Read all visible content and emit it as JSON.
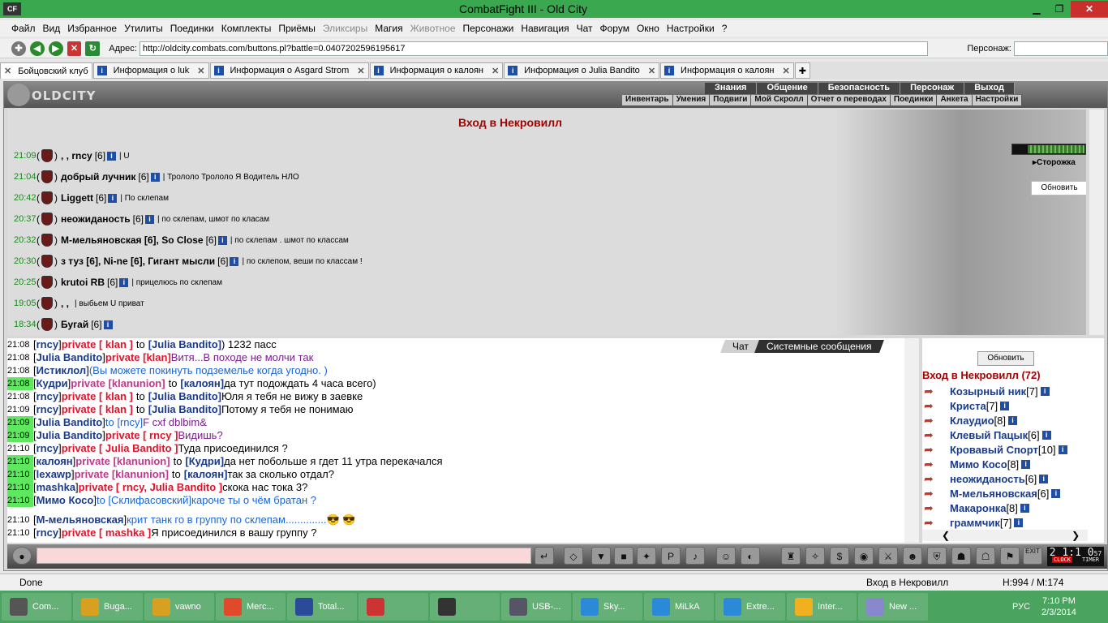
{
  "window": {
    "title": "CombatFight III - Old City",
    "logo": "CF"
  },
  "menu": [
    "Файл",
    "Вид",
    "Избранное",
    "Утилиты",
    "Поединки",
    "Комплекты",
    "Приёмы",
    "Эликсиры",
    "Магия",
    "Животное",
    "Персонажи",
    "Навигация",
    "Чат",
    "Форум",
    "Окно",
    "Настройки",
    "?"
  ],
  "address": {
    "label": "Адрес:",
    "url": "http://oldcity.combats.com/buttons.pl?battle=0.0407202596195617",
    "person_label": "Персонаж:"
  },
  "tabs": [
    {
      "label": "Бойцовский клуб"
    },
    {
      "label": "Информация о luk"
    },
    {
      "label": "Информация о Asgard Strom"
    },
    {
      "label": "Информация о калоян"
    },
    {
      "label": "Информация о Julia Bandito"
    },
    {
      "label": "Информация о калоян"
    }
  ],
  "header": {
    "logo": "OLDCITY",
    "top_nav": [
      "Знания",
      "Общение",
      "Безопасность",
      "Персонаж",
      "Выход"
    ],
    "sub_nav": [
      "Инвентарь",
      "Умения",
      "Подвиги",
      "Мой Скролл",
      "Отчет о переводах",
      "Поединки",
      "Анкета",
      "Настройки"
    ]
  },
  "room": {
    "title": "Вход в Некровилл",
    "guard_label": "Сторожка",
    "refresh_label": "Обновить",
    "entries": [
      {
        "time": "21:09",
        "names": ", , rncy",
        "level": "[6]",
        "text": "| U"
      },
      {
        "time": "21:04",
        "names": "добрый лучник",
        "level": "[6]",
        "text": "| Трололо Трололо Я Водитель НЛО"
      },
      {
        "time": "20:42",
        "names": "Liggett",
        "level": "[6]",
        "text": "| По склепам"
      },
      {
        "time": "20:37",
        "names": "неожиданость",
        "level": "[6]",
        "text": "| по склепам, шмот по класам"
      },
      {
        "time": "20:32",
        "names": "М-мельяновская [6], So Close",
        "level": "[6]",
        "text": "| по склепам . шмот по классам"
      },
      {
        "time": "20:30",
        "names": "з туз [6], Ni-ne [6], Гигант мысли",
        "level": "[6]",
        "text": "| по склепом, веши по классам !"
      },
      {
        "time": "20:25",
        "names": "krutoi RB",
        "level": "[6]",
        "text": "| прицелюсь по склепам"
      },
      {
        "time": "19:05",
        "names": ", ,",
        "level": "",
        "text": "| выбьем U приват"
      },
      {
        "time": "18:34",
        "names": "Бугай",
        "level": "[6]",
        "text": ""
      }
    ]
  },
  "chat": {
    "tabs": [
      "Чат",
      "Системные сообщения"
    ],
    "lines": [
      {
        "time": "21:08",
        "hl": false,
        "nick": "rncy",
        "priv": "private [ klan ]",
        "to": "to",
        "target": "[Julia Bandito]",
        "text": ") 1232 пасс",
        "style": "red"
      },
      {
        "time": "21:08",
        "hl": false,
        "nick": "Julia Bandito",
        "priv": "private [klan]",
        "to": "",
        "target": "",
        "text": "Витя...В походе не молчи так",
        "style": "red"
      },
      {
        "time": "21:08",
        "hl": false,
        "nick": "Истиклол",
        "priv": "",
        "to": "",
        "target": "",
        "text": "(Вы можете покинуть подземелье когда угодно. )",
        "style": "blue"
      },
      {
        "time": "21:08",
        "hl": true,
        "nick": "Кудри",
        "priv": "private [klanunion]",
        "to": "to",
        "target": "[калоян]",
        "text": "да тут подождать 4 часа всего)",
        "style": "pink"
      },
      {
        "time": "21:08",
        "hl": false,
        "nick": "rncy",
        "priv": "private [ klan ]",
        "to": "to",
        "target": "[Julia Bandito]",
        "text": "Юля я тебя не вижу в заевке",
        "style": "red"
      },
      {
        "time": "21:09",
        "hl": false,
        "nick": "rncy",
        "priv": "private [ klan ]",
        "to": "to",
        "target": "[Julia Bandito]",
        "text": "Потому я тебя не понимаю",
        "style": "red"
      },
      {
        "time": "21:09",
        "hl": true,
        "nick": "Julia Bandito",
        "priv": "to [rncy]",
        "to": "",
        "target": "",
        "text": "F cxf dblbim&",
        "style": "purple"
      },
      {
        "time": "21:09",
        "hl": true,
        "nick": "Julia Bandito",
        "priv": "private [ rncy ]",
        "to": "",
        "target": "",
        "text": "Видишь?",
        "style": "red"
      },
      {
        "time": "21:10",
        "hl": false,
        "nick": "rncy",
        "priv": "private [ Julia Bandito ]",
        "to": "",
        "target": "",
        "text": "Туда присоединился ?",
        "style": "red"
      },
      {
        "time": "21:10",
        "hl": true,
        "nick": "калоян",
        "priv": "private [klanunion]",
        "to": "to",
        "target": "[Кудри]",
        "text": "да нет побольше я гдет 11 утра перекачался",
        "style": "pink"
      },
      {
        "time": "21:10",
        "hl": true,
        "nick": "lexawp",
        "priv": "private [klanunion]",
        "to": "to",
        "target": "[калоян]",
        "text": "так за сколько отдал?",
        "style": "pink"
      },
      {
        "time": "21:10",
        "hl": true,
        "nick": "mashka",
        "priv": "private [ rncy, Julia Bandito ]",
        "to": "",
        "target": "",
        "text": "скока нас тока 3?",
        "style": "red"
      },
      {
        "time": "21:10",
        "hl": true,
        "nick": "Мимо Косо",
        "priv": "to [Склифасовский]",
        "to": "",
        "target": "",
        "text": "кароче ты о чём братан ?",
        "style": "blue"
      },
      {
        "time": "21:10",
        "hl": false,
        "nick": "М-мельяновская",
        "priv": "",
        "to": "",
        "target": "",
        "text": "крит танк го в группу по склепам..............",
        "style": "blue2"
      },
      {
        "time": "21:10",
        "hl": false,
        "nick": "rncy",
        "priv": "private [ mashka ]",
        "to": "",
        "target": "",
        "text": "Я присоединился в вашу группу ?",
        "style": "red"
      }
    ]
  },
  "users": {
    "refresh_label": "Обновить",
    "title": "Вход в Некровилл (72)",
    "list": [
      {
        "name": "Козырный ник",
        "level": "[7]"
      },
      {
        "name": "Криста",
        "level": "[7]"
      },
      {
        "name": "Клаудио",
        "level": "[8]"
      },
      {
        "name": "Клевый Пацык",
        "level": "[6]"
      },
      {
        "name": "Кровавый Спорт",
        "level": "[10]"
      },
      {
        "name": "Мимо Косо",
        "level": "[8]"
      },
      {
        "name": "неожиданость",
        "level": "[6]"
      },
      {
        "name": "М-мельяновская",
        "level": "[6]"
      },
      {
        "name": "Макаронка",
        "level": "[8]"
      },
      {
        "name": "граммчик",
        "level": "[7]"
      }
    ]
  },
  "clock": {
    "time": "2 1:1 0",
    "sec": "57",
    "clock_label": "CLOCK",
    "timer_label": "TIMER",
    "exit_label": "EXIT"
  },
  "status": {
    "text": "Done",
    "location": "Вход в Некровилл",
    "hm": "H:994 / M:174"
  },
  "taskbar": {
    "items": [
      "Com...",
      "Buga...",
      "vawno",
      "Merc...",
      "Total...",
      "",
      "",
      "USB-...",
      "Sky...",
      "MiLkA",
      "Extre...",
      "Inter...",
      "New ..."
    ],
    "lang": "РУС",
    "time": "7:10 PM",
    "date": "2/3/2014"
  }
}
